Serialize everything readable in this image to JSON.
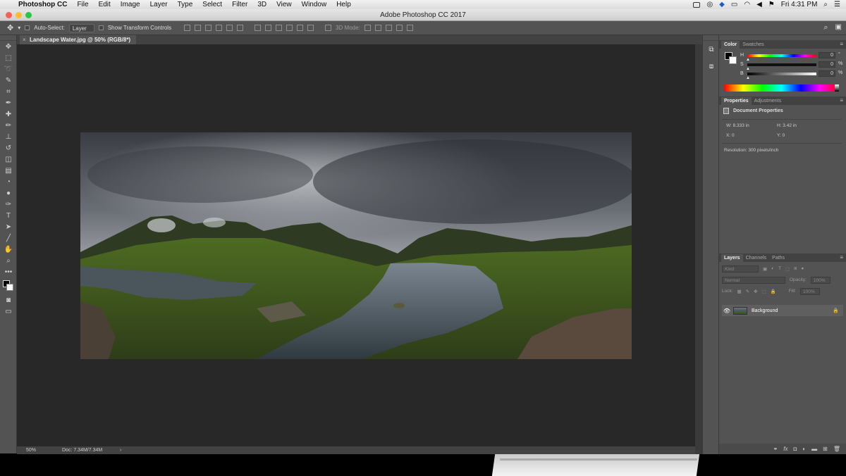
{
  "menubar": {
    "app_name": "Photoshop CC",
    "items": [
      "File",
      "Edit",
      "Image",
      "Layer",
      "Type",
      "Select",
      "Filter",
      "3D",
      "View",
      "Window",
      "Help"
    ],
    "clock": "Fri 4:31 PM"
  },
  "window": {
    "title": "Adobe Photoshop CC 2017"
  },
  "options_bar": {
    "auto_select_label": "Auto-Select:",
    "auto_select_value": "Layer",
    "show_transform_label": "Show Transform Controls",
    "mode_3d_label": "3D Mode:"
  },
  "document": {
    "tab_title": "Landscape Water.jpg @ 50% (RGB/8*)",
    "zoom": "50%",
    "doc_size": "Doc: 7.34M/7.34M"
  },
  "color_panel": {
    "tabs": [
      "Color",
      "Swatches"
    ],
    "sliders": [
      {
        "label": "H",
        "value": "0",
        "unit": "°"
      },
      {
        "label": "S",
        "value": "0",
        "unit": "%"
      },
      {
        "label": "B",
        "value": "0",
        "unit": "%"
      }
    ]
  },
  "properties_panel": {
    "tabs": [
      "Properties",
      "Adjustments"
    ],
    "header": "Document Properties",
    "w": "W:  8.333 in",
    "h": "H:  3.42 in",
    "x": "X:  0",
    "y": "Y:  0",
    "resolution": "Resolution: 300 pixels/inch"
  },
  "layers_panel": {
    "tabs": [
      "Layers",
      "Channels",
      "Paths"
    ],
    "filter_placeholder": "Kind",
    "blend_mode": "Normal",
    "opacity_label": "Opacity:",
    "opacity_value": "100%",
    "lock_label": "Lock:",
    "fill_label": "Fill:",
    "fill_value": "100%",
    "layer_name": "Background"
  },
  "colors": {
    "panel_bg": "#535353",
    "canvas_bg": "#282828",
    "foreground": "#000000",
    "background": "#ffffff"
  }
}
